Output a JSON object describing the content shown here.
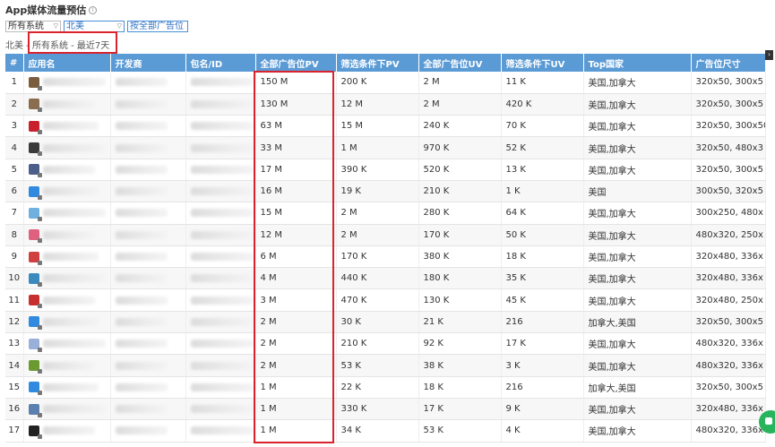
{
  "title": "App媒体流量预估",
  "filters": {
    "os": "所有系统",
    "region": "北美",
    "metric": "按全部广告位"
  },
  "summary": "北美 - 所有系统 - 最近7天",
  "columns": [
    "#",
    "应用名",
    "开发商",
    "包名/ID",
    "全部广告位PV",
    "筛选条件下PV",
    "全部广告位UV",
    "筛选条件下UV",
    "Top国家",
    "广告位尺寸"
  ],
  "icon_colors": [
    "#7a5c3e",
    "#8a6d4f",
    "#c8202d",
    "#3a3a3a",
    "#4b5f8a",
    "#2f8ae0",
    "#6fb0e0",
    "#e06080",
    "#d04040",
    "#3a8ac0",
    "#c83030",
    "#2f8ae0",
    "#9ab0d8",
    "#6a9a30",
    "#2f8ae0",
    "#5a7fb0",
    "#222222"
  ],
  "rows": [
    {
      "n": "1",
      "pv_all": "150 M",
      "pv_f": "200 K",
      "uv_all": "2 M",
      "uv_f": "11 K",
      "country": "美国,加拿大",
      "size": "320x50, 300x5"
    },
    {
      "n": "2",
      "pv_all": "130 M",
      "pv_f": "12 M",
      "uv_all": "2 M",
      "uv_f": "420 K",
      "country": "美国,加拿大",
      "size": "320x50, 300x5"
    },
    {
      "n": "3",
      "pv_all": "63 M",
      "pv_f": "15 M",
      "uv_all": "240 K",
      "uv_f": "70 K",
      "country": "美国,加拿大",
      "size": "320x50, 300x50"
    },
    {
      "n": "4",
      "pv_all": "33 M",
      "pv_f": "1 M",
      "uv_all": "970 K",
      "uv_f": "52 K",
      "country": "美国,加拿大",
      "size": "320x50, 480x3"
    },
    {
      "n": "5",
      "pv_all": "17 M",
      "pv_f": "390 K",
      "uv_all": "520 K",
      "uv_f": "13 K",
      "country": "美国,加拿大",
      "size": "320x50, 300x5"
    },
    {
      "n": "6",
      "pv_all": "16 M",
      "pv_f": "19 K",
      "uv_all": "210 K",
      "uv_f": "1 K",
      "country": "美国",
      "size": "300x50, 320x5"
    },
    {
      "n": "7",
      "pv_all": "15 M",
      "pv_f": "2 M",
      "uv_all": "280 K",
      "uv_f": "64 K",
      "country": "美国,加拿大",
      "size": "300x250, 480x"
    },
    {
      "n": "8",
      "pv_all": "12 M",
      "pv_f": "2 M",
      "uv_all": "170 K",
      "uv_f": "50 K",
      "country": "美国,加拿大",
      "size": "480x320, 250x"
    },
    {
      "n": "9",
      "pv_all": "6 M",
      "pv_f": "170 K",
      "uv_all": "380 K",
      "uv_f": "18 K",
      "country": "美国,加拿大",
      "size": "320x480, 336x"
    },
    {
      "n": "10",
      "pv_all": "4 M",
      "pv_f": "440 K",
      "uv_all": "180 K",
      "uv_f": "35 K",
      "country": "美国,加拿大",
      "size": "320x480, 336x"
    },
    {
      "n": "11",
      "pv_all": "3 M",
      "pv_f": "470 K",
      "uv_all": "130 K",
      "uv_f": "45 K",
      "country": "美国,加拿大",
      "size": "320x480, 250x"
    },
    {
      "n": "12",
      "pv_all": "2 M",
      "pv_f": "30 K",
      "uv_all": "21 K",
      "uv_f": "216",
      "country": "加拿大,美国",
      "size": "320x50, 300x5"
    },
    {
      "n": "13",
      "pv_all": "2 M",
      "pv_f": "210 K",
      "uv_all": "92 K",
      "uv_f": "17 K",
      "country": "美国,加拿大",
      "size": "480x320, 336x"
    },
    {
      "n": "14",
      "pv_all": "2 M",
      "pv_f": "53 K",
      "uv_all": "38 K",
      "uv_f": "3 K",
      "country": "美国,加拿大",
      "size": "480x320, 336x"
    },
    {
      "n": "15",
      "pv_all": "1 M",
      "pv_f": "22 K",
      "uv_all": "18 K",
      "uv_f": "216",
      "country": "加拿大,美国",
      "size": "320x50, 300x5"
    },
    {
      "n": "16",
      "pv_all": "1 M",
      "pv_f": "330 K",
      "uv_all": "17 K",
      "uv_f": "9 K",
      "country": "美国,加拿大",
      "size": "320x480, 336x"
    },
    {
      "n": "17",
      "pv_all": "1 M",
      "pv_f": "34 K",
      "uv_all": "53 K",
      "uv_f": "4 K",
      "country": "美国,加拿大",
      "size": "480x320, 336x"
    }
  ]
}
